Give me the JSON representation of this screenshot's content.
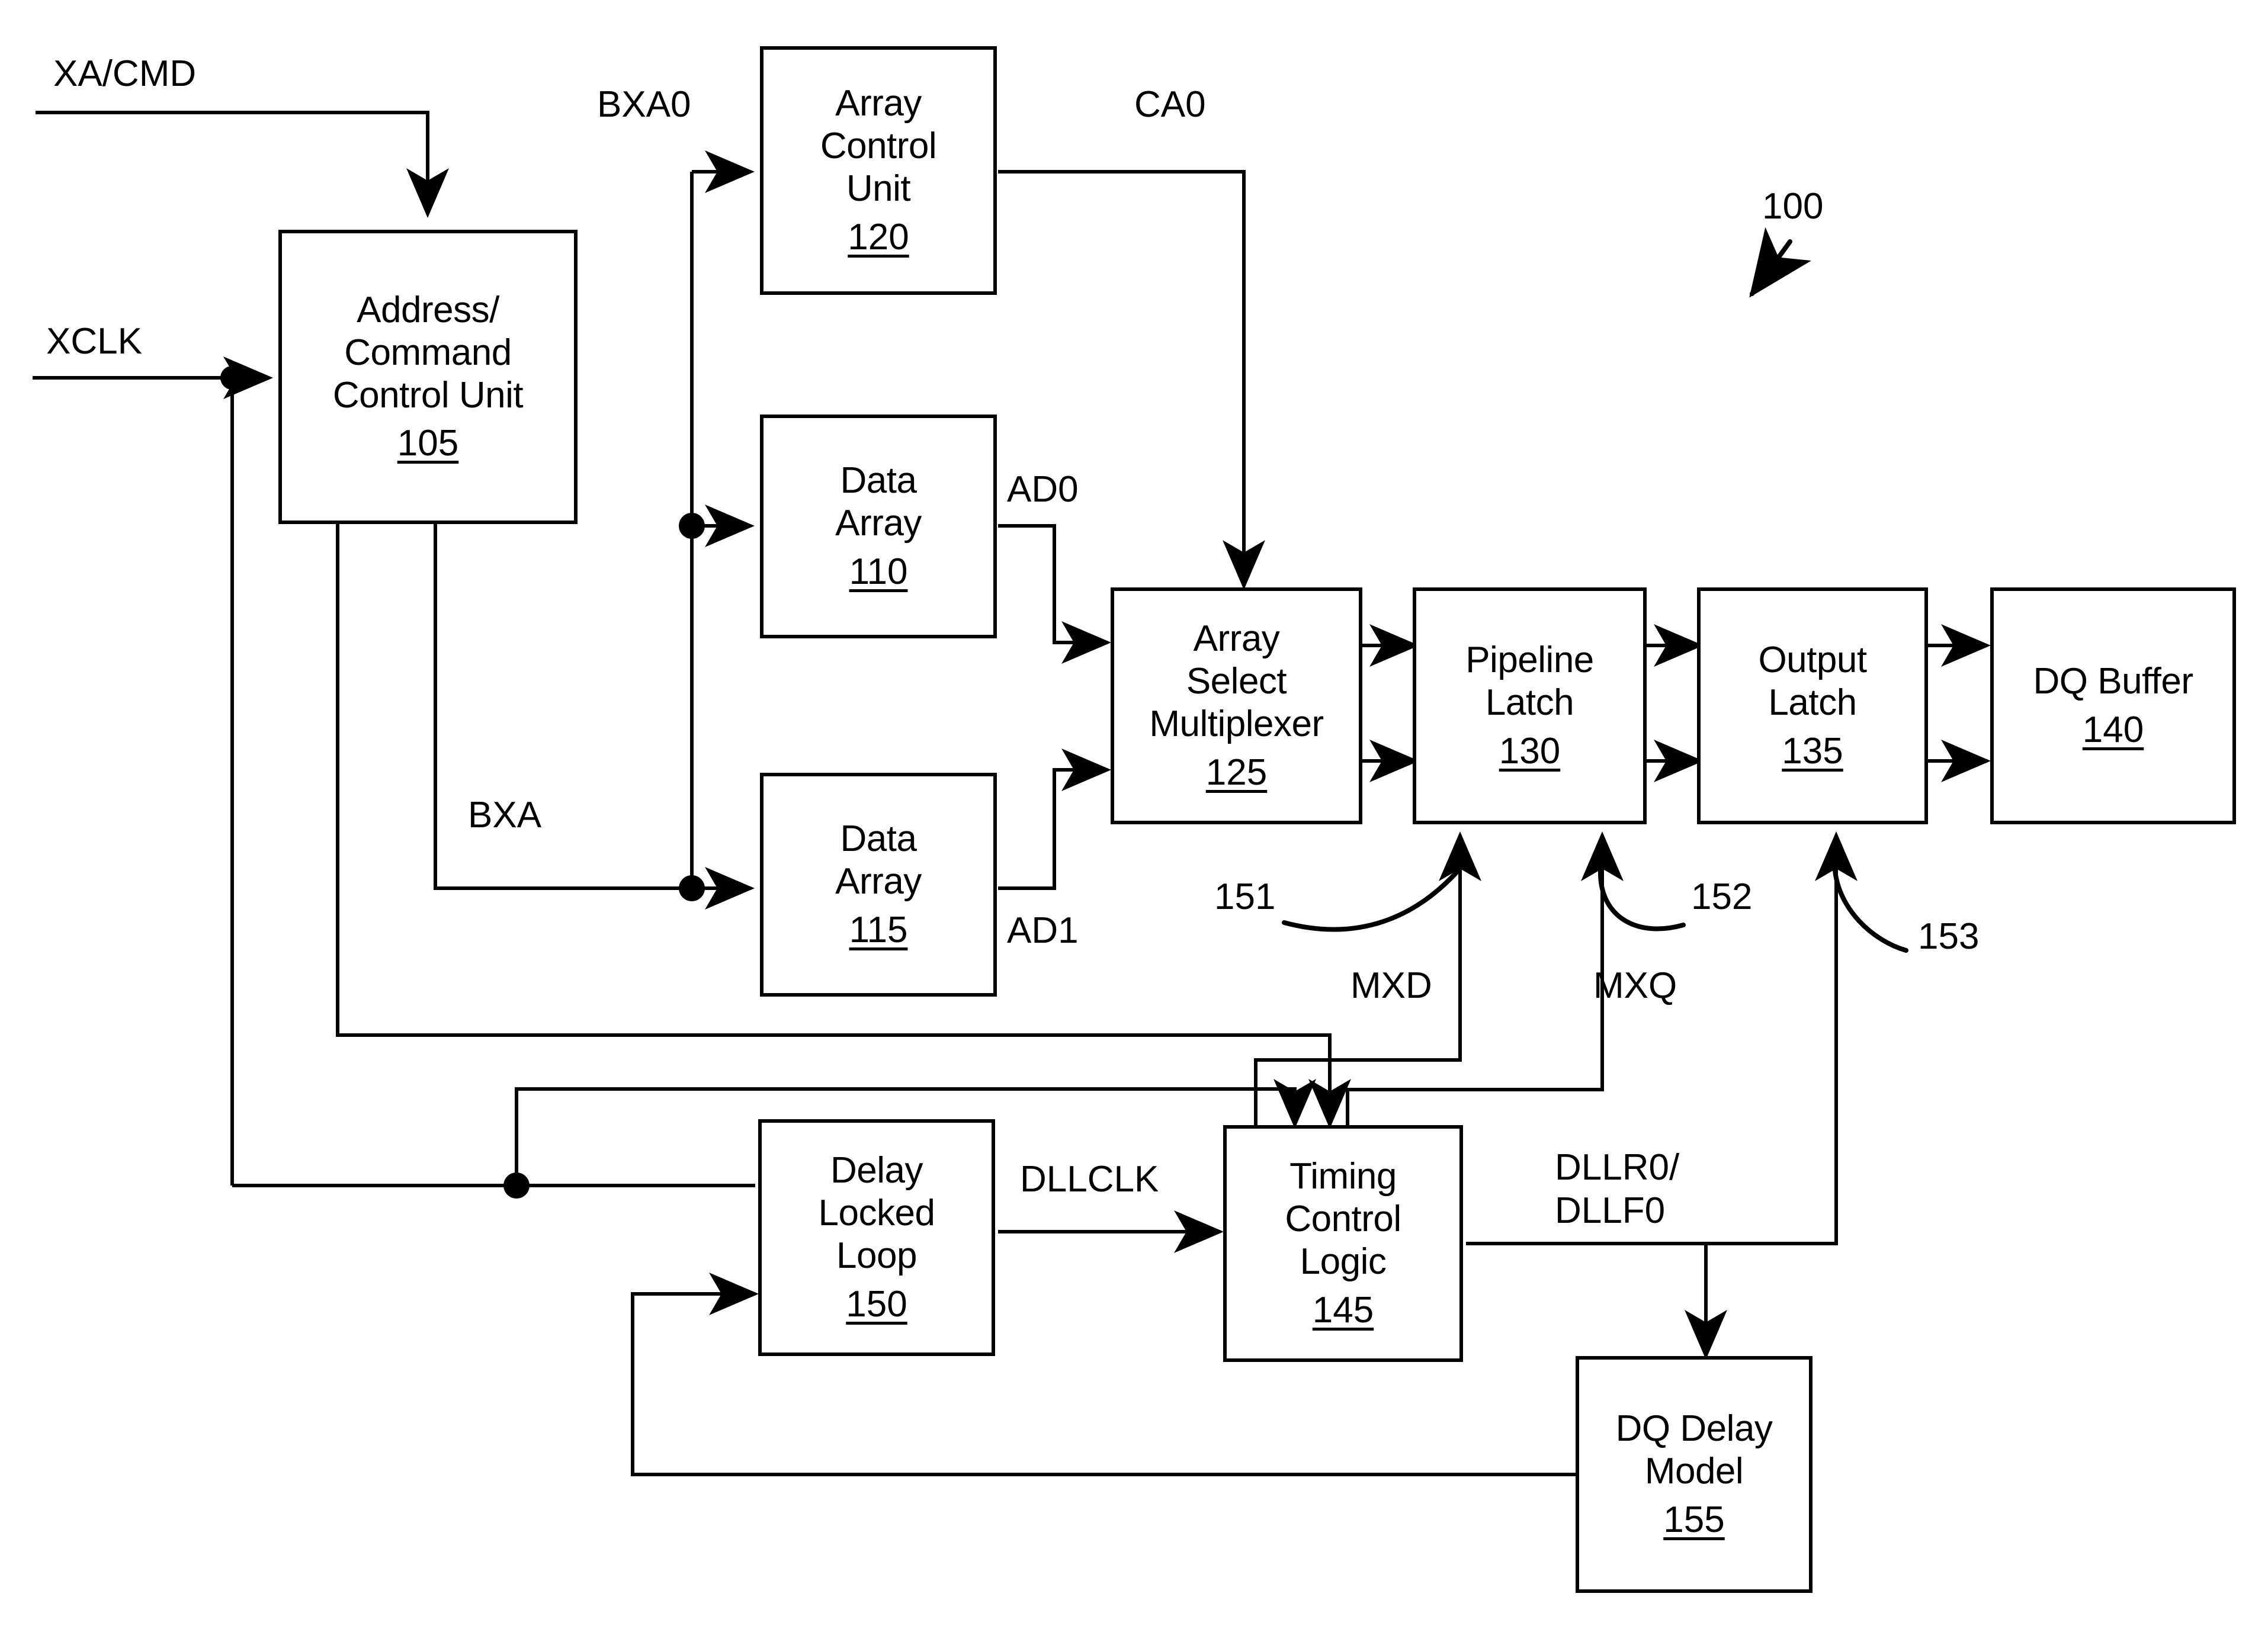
{
  "figure": {
    "reference_numeral": "100"
  },
  "blocks": [
    {
      "id": "acu",
      "title": "Address/\nCommand\nControl Unit",
      "refnum": "105"
    },
    {
      "id": "arrayctl",
      "title": "Array\nControl\nUnit",
      "refnum": "120"
    },
    {
      "id": "array0",
      "title": "Data\nArray",
      "refnum": "110"
    },
    {
      "id": "array1",
      "title": "Data\nArray",
      "refnum": "115"
    },
    {
      "id": "mux",
      "title": "Array\nSelect\nMultiplexer",
      "refnum": "125"
    },
    {
      "id": "pipelatch",
      "title": "Pipeline\nLatch",
      "refnum": "130"
    },
    {
      "id": "outlatch",
      "title": "Output\nLatch",
      "refnum": "135"
    },
    {
      "id": "dqbuf",
      "title": "DQ Buffer",
      "refnum": "140"
    },
    {
      "id": "dll",
      "title": "Delay\nLocked\nLoop",
      "refnum": "150"
    },
    {
      "id": "tcl",
      "title": "Timing\nControl\nLogic",
      "refnum": "145"
    },
    {
      "id": "dqdelay",
      "title": "DQ Delay\nModel",
      "refnum": "155"
    }
  ],
  "signals": {
    "xa_cmd": "XA/CMD",
    "xclk": "XCLK",
    "bxa0": "BXA0",
    "bxa": "BXA",
    "ca0": "CA0",
    "ad0": "AD0",
    "ad1": "AD1",
    "mxd": "MXD",
    "mxq": "MXQ",
    "dllclk": "DLLCLK",
    "dllr0_dllf0": "DLLR0/\nDLLF0"
  },
  "callouts": [
    {
      "id": "c151",
      "label": "151"
    },
    {
      "id": "c152",
      "label": "152"
    },
    {
      "id": "c153",
      "label": "153"
    }
  ],
  "colors": {
    "stroke": "#000000",
    "background": "#ffffff"
  }
}
